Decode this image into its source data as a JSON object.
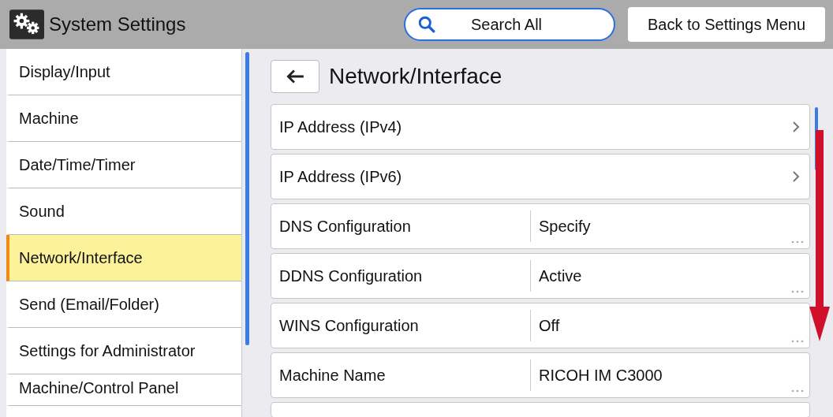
{
  "header": {
    "title": "System Settings",
    "search_button": "Search All",
    "back_button": "Back to Settings Menu"
  },
  "sidebar": {
    "items": [
      {
        "label": "Display/Input",
        "selected": false
      },
      {
        "label": "Machine",
        "selected": false
      },
      {
        "label": "Date/Time/Timer",
        "selected": false
      },
      {
        "label": "Sound",
        "selected": false
      },
      {
        "label": "Network/Interface",
        "selected": true
      },
      {
        "label": "Send (Email/Folder)",
        "selected": false
      },
      {
        "label": "Settings for Administrator",
        "selected": false
      },
      {
        "label": "Machine/Control Panel",
        "selected": false
      }
    ]
  },
  "panel": {
    "title": "Network/Interface",
    "rows": [
      {
        "kind": "link",
        "label": "IP Address (IPv4)"
      },
      {
        "kind": "link",
        "label": "IP Address (IPv6)"
      },
      {
        "kind": "value",
        "label": "DNS Configuration",
        "value": "Specify"
      },
      {
        "kind": "value",
        "label": "DDNS Configuration",
        "value": "Active"
      },
      {
        "kind": "value",
        "label": "WINS Configuration",
        "value": "Off"
      },
      {
        "kind": "value",
        "label": "Machine Name",
        "value": "RICOH IM C3000"
      }
    ]
  }
}
